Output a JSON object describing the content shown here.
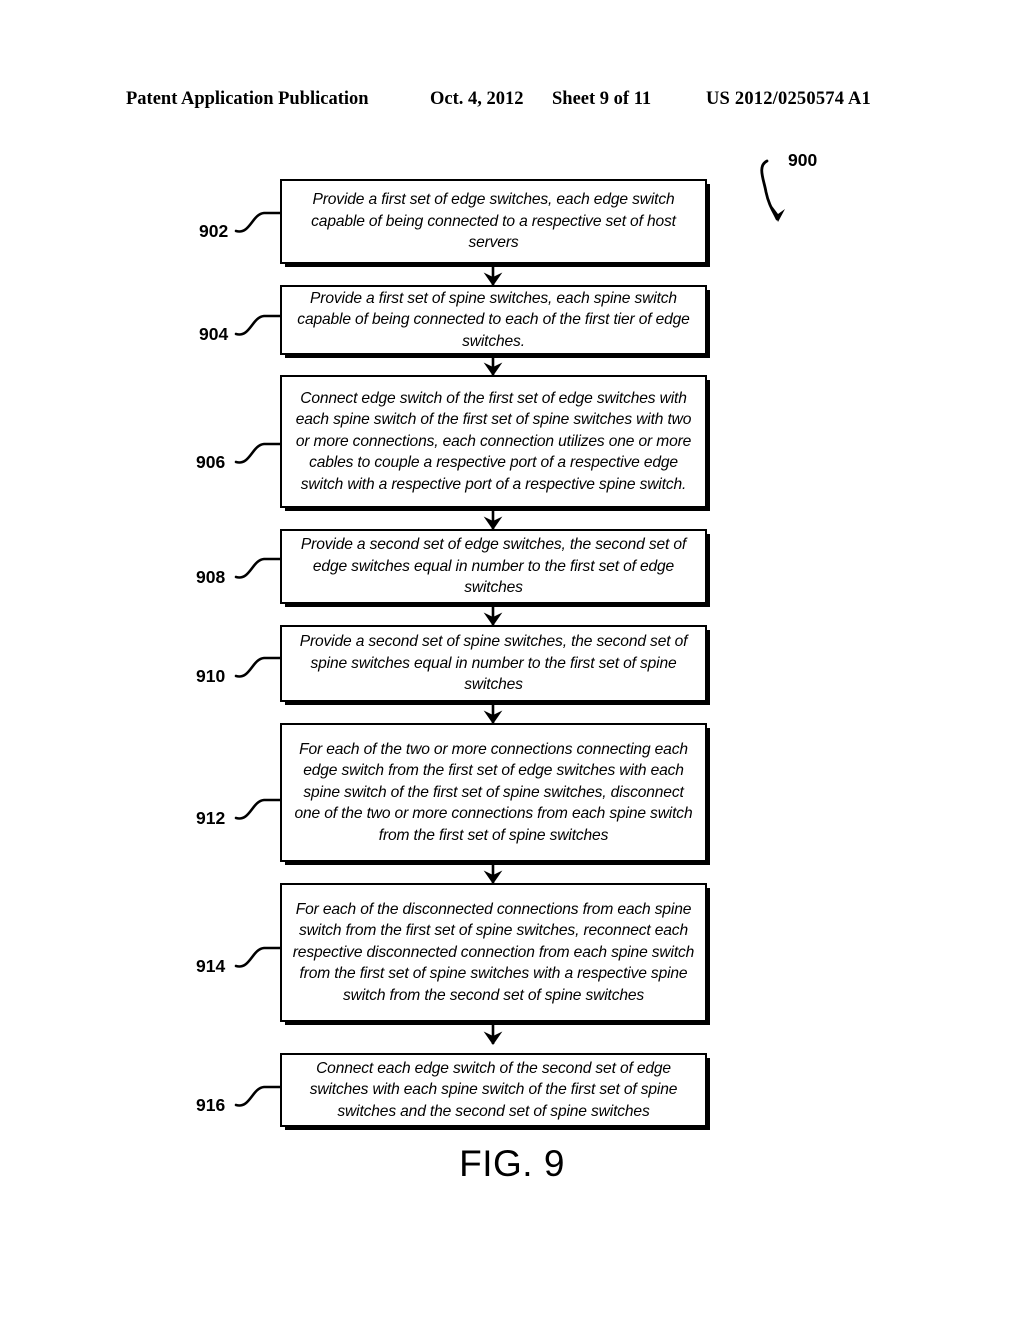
{
  "header": {
    "publication": "Patent Application Publication",
    "date": "Oct. 4, 2012",
    "sheet": "Sheet 9 of 11",
    "patent_number": "US 2012/0250574 A1"
  },
  "figure": {
    "caption": "FIG. 9",
    "diagram_ref": "900"
  },
  "flowchart": {
    "steps": [
      {
        "ref": "902",
        "text": "Provide a first set of edge switches, each edge switch capable of being connected to a respective set of host servers"
      },
      {
        "ref": "904",
        "text": "Provide a first set of spine switches, each spine switch capable of being connected to each of the first tier of edge switches."
      },
      {
        "ref": "906",
        "text": "Connect edge switch of the first set of edge switches with each spine switch of the first set of spine switches with two or more connections, each connection utilizes one or more cables to couple a respective port of a respective edge switch with a respective port of a respective spine switch."
      },
      {
        "ref": "908",
        "text": "Provide a second set of edge switches, the second set of edge switches equal in number to the first set of edge switches"
      },
      {
        "ref": "910",
        "text": "Provide a second set of spine switches, the second set of spine switches equal in number to the first set of spine switches"
      },
      {
        "ref": "912",
        "text": "For each of the two or more connections connecting each edge switch from the first set of edge switches with each spine switch of the first set of spine switches, disconnect one of the two or more connections from each spine switch from the first set of spine switches"
      },
      {
        "ref": "914",
        "text": "For each of the disconnected connections from each spine switch from the first set of spine switches, reconnect each respective disconnected connection from each spine switch from the first set of spine switches with a respective spine switch from the second set of spine switches"
      },
      {
        "ref": "916",
        "text": "Connect each edge switch of the second set of edge switches with each spine switch of the first set of spine switches and the second set of spine switches"
      }
    ]
  },
  "colors": {
    "ink": "#000000",
    "paper": "#ffffff"
  }
}
